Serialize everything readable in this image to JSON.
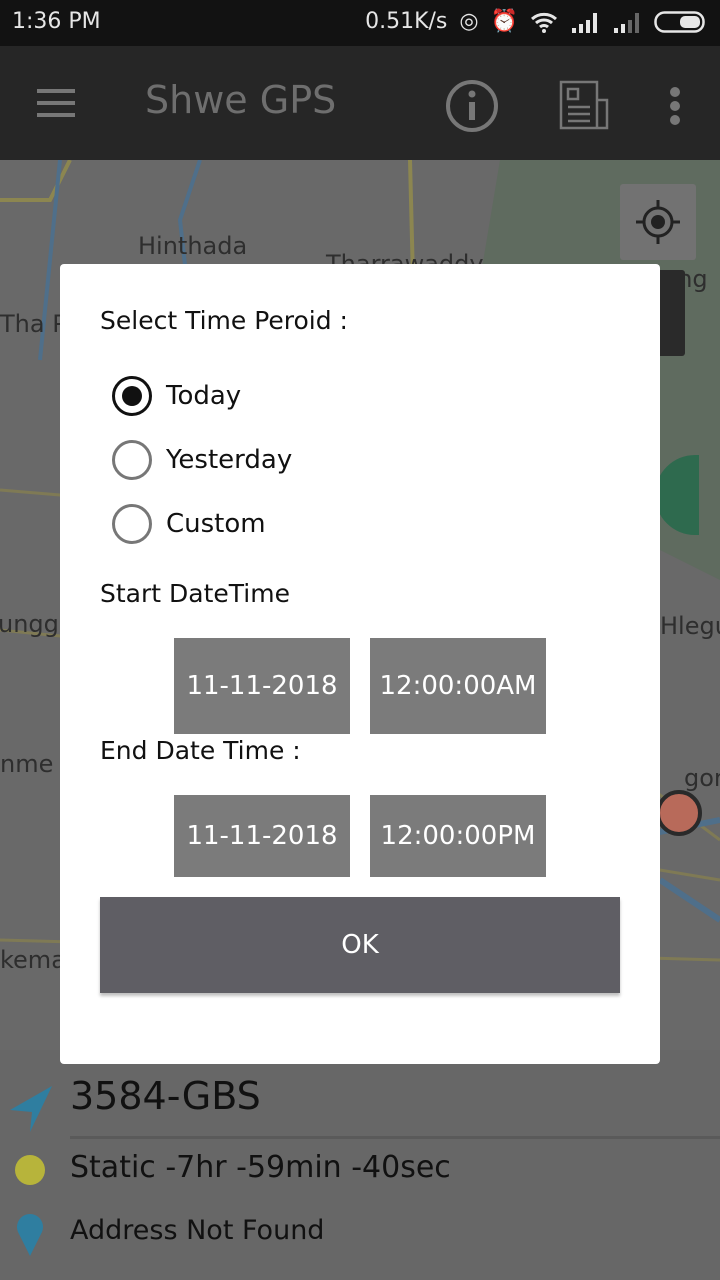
{
  "status_bar": {
    "time": "1:36 PM",
    "net_speed": "0.51K/s",
    "icons": [
      "hotspot-icon",
      "alarm-icon",
      "wifi-icon",
      "signal-icon",
      "signal-icon",
      "battery-icon"
    ]
  },
  "app_bar": {
    "title": "Shwe GPS",
    "icons": [
      "menu-icon",
      "info-icon",
      "news-icon",
      "more-vert-icon"
    ]
  },
  "map": {
    "labels": [
      "Hinthada",
      "Tharrawaddy",
      "Tha Py",
      "unggo",
      "nme",
      "kema",
      "Hlegu",
      "ung",
      "gon"
    ]
  },
  "dialog": {
    "heading": "Select Time Peroid :",
    "options": [
      {
        "label": "Today",
        "selected": true
      },
      {
        "label": "Yesterday",
        "selected": false
      },
      {
        "label": "Custom",
        "selected": false
      }
    ],
    "start_label": "Start DateTime",
    "start_date": "11-11-2018",
    "start_time": "12:00:00AM",
    "end_label": "End Date Time :",
    "end_date": "11-11-2018",
    "end_time": "12:00:00PM",
    "ok_label": "OK"
  },
  "vehicle": {
    "name": "3584-GBS",
    "status": "Static -7hr -59min -40sec",
    "address": "Address Not Found",
    "status_color": "#c9c23a",
    "accent": "#2f7ea0"
  }
}
